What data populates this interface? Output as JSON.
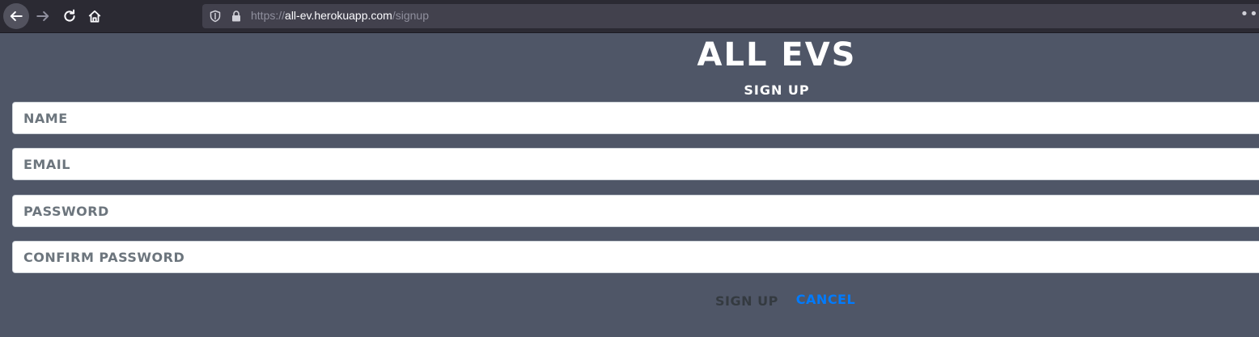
{
  "browser": {
    "url_host": "all-ev.herokuapp.com",
    "url_path": "/signup",
    "url_scheme": "https://",
    "icons": [
      "back-arrow-icon",
      "forward-arrow-icon",
      "reload-icon",
      "home-icon",
      "tracking-shield-icon",
      "lock-icon",
      "more-icon"
    ]
  },
  "page": {
    "title": "All EVs",
    "subtitle": "Sign Up"
  },
  "form": {
    "name_placeholder": "Name",
    "email_placeholder": "Email",
    "password_placeholder": "Password",
    "confirm_password_placeholder": "Confirm Password",
    "submit_label": "Sign Up",
    "cancel_label": "Cancel"
  },
  "colors": {
    "page_background": "#4f5667",
    "cancel_link": "#007bff",
    "submit_text": "#343a40"
  }
}
